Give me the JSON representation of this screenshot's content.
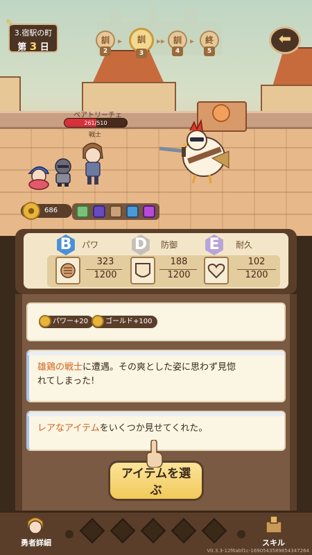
{
  "location": {
    "name": "3.宿駅の町",
    "day_prefix": "第",
    "day": "3",
    "day_suffix": "日"
  },
  "progress": [
    {
      "label": "訓",
      "num": "2"
    },
    {
      "label": "訓",
      "num": "3",
      "active": true
    },
    {
      "label": "訓",
      "num": "4"
    },
    {
      "label": "終",
      "num": "5"
    }
  ],
  "back_icon": "arrow-left-icon",
  "enemy": {
    "name": "ベアトリーチェ",
    "hp": "261/510",
    "hp_fraction": 0.512,
    "class": "戦士"
  },
  "gold": {
    "value": "686"
  },
  "stats": [
    {
      "grade": "B",
      "label": "パワ",
      "value": "323",
      "max": "1200",
      "icon": "fist-icon"
    },
    {
      "grade": "D",
      "label": "防御",
      "value": "188",
      "max": "1200",
      "icon": "shield-icon"
    },
    {
      "grade": "E",
      "label": "耐久",
      "value": "102",
      "max": "1200",
      "icon": "heart-icon"
    }
  ],
  "rewards": [
    {
      "text": "パワー+20"
    },
    {
      "text": "ゴールド+100"
    }
  ],
  "messages": {
    "m1_hl": "雄鶏の戦士",
    "m1_rest_line1": "に遭遇。その爽とした姿に思わず見惚",
    "m1_line2": "れてしまった!",
    "m2_hl": "レアなアイテム",
    "m2_rest": "をいくつか見せてくれた。"
  },
  "select_button": {
    "line1": "アイテムを選",
    "line2": "ぶ"
  },
  "bottom_nav": {
    "left_label": "勇者詳細",
    "right_label": "スキル"
  },
  "version": "V0.3.3-12f6abf1c-1690543589854347264"
}
